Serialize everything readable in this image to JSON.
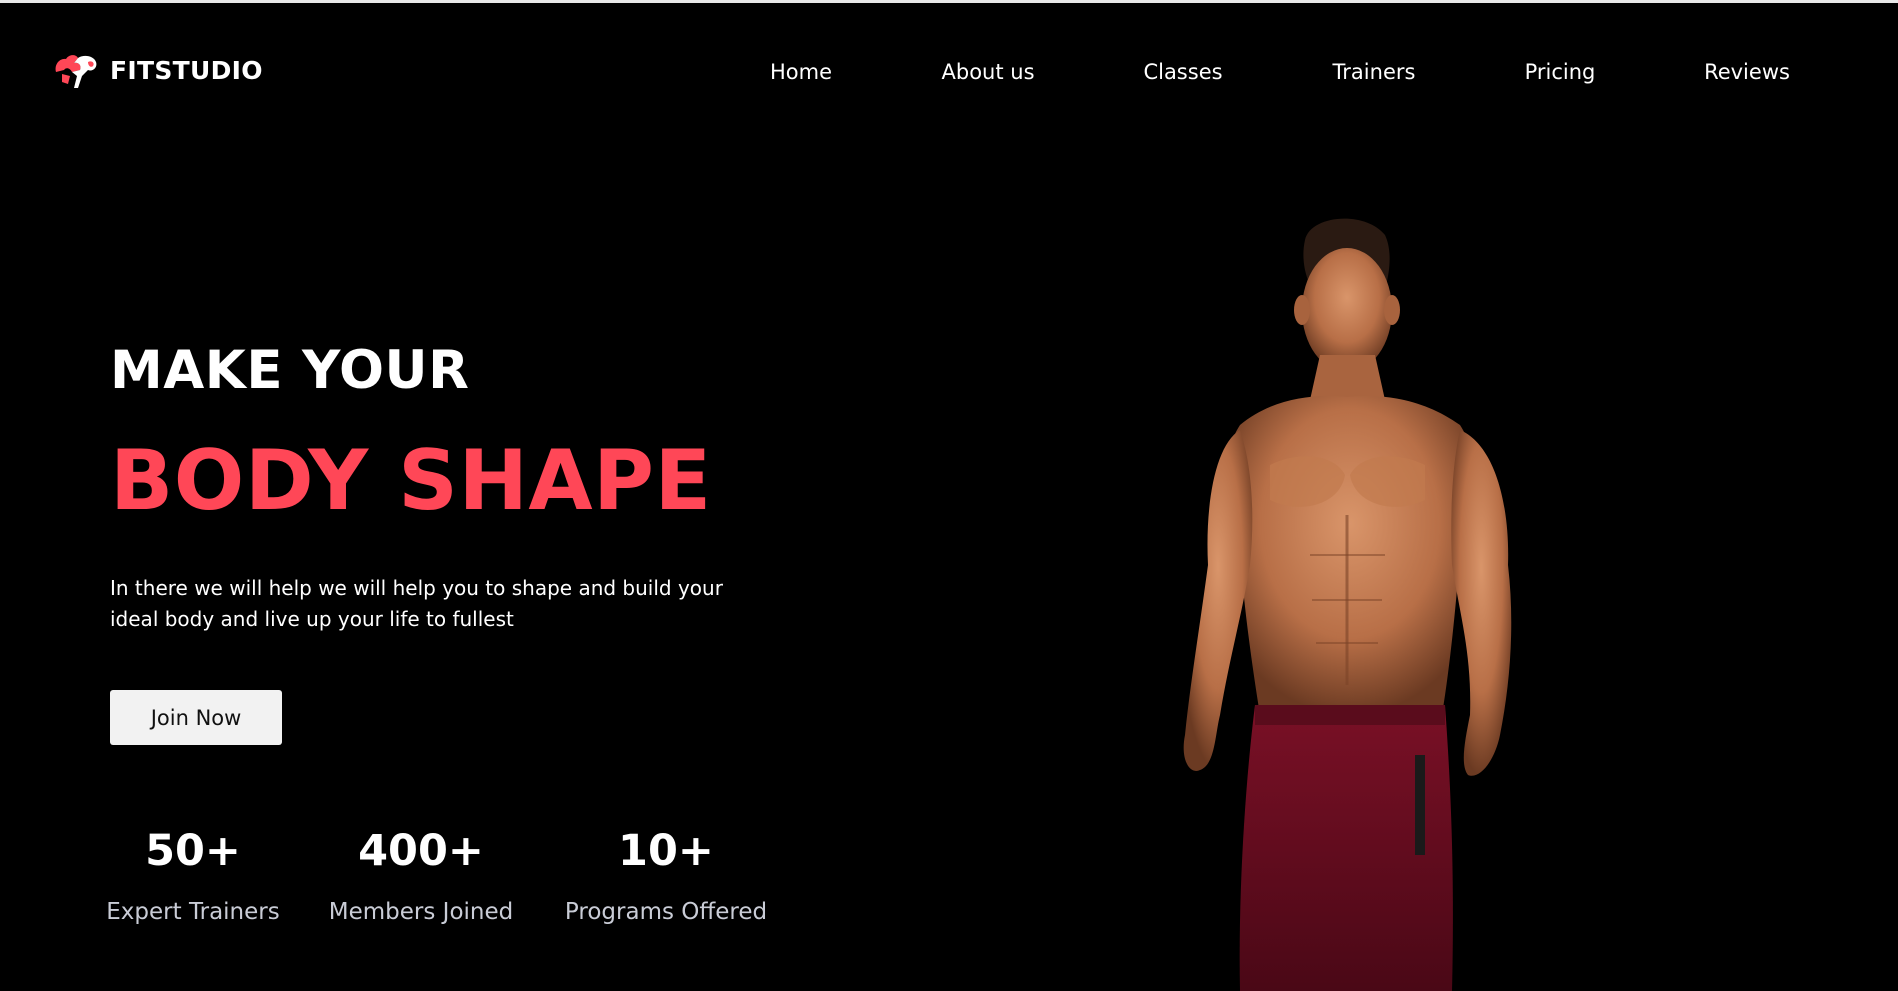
{
  "brand": {
    "name": "FITSTUDIO",
    "logo_icon": "flexing-arm-icon",
    "accent_color": "#ff4757"
  },
  "nav": {
    "items": [
      "Home",
      "About us",
      "Classes",
      "Trainers",
      "Pricing",
      "Reviews"
    ]
  },
  "hero": {
    "title_line1": "MAKE YOUR",
    "title_line2": "BODY SHAPE",
    "description": "In there we will help we will help you to shape and build your ideal body and live up your life to fullest",
    "cta_label": "Join Now",
    "image": "shirtless-athlete-photo"
  },
  "stats": [
    {
      "value": "50+",
      "label": "Expert Trainers"
    },
    {
      "value": "400+",
      "label": "Members Joined"
    },
    {
      "value": "10+",
      "label": "Programs Offered"
    }
  ],
  "colors": {
    "background": "#000000",
    "text": "#ffffff",
    "muted_text": "#c9ccd6",
    "button_bg": "#f2f2f2",
    "shorts": "#6e0f22"
  }
}
